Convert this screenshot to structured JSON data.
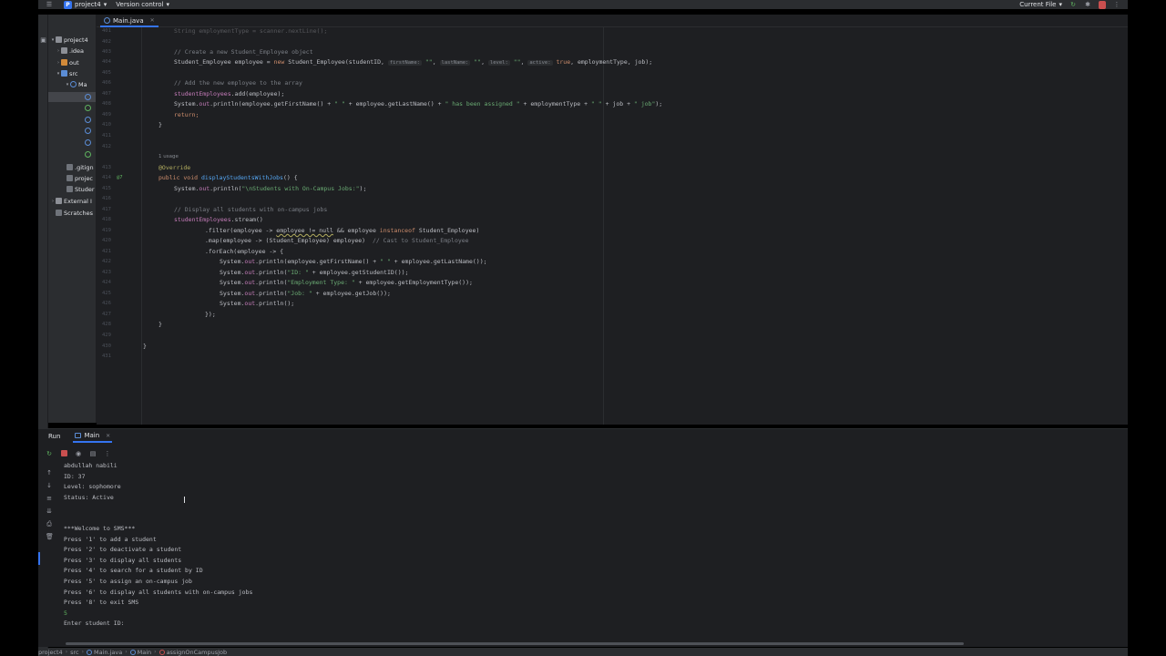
{
  "titlebar": {
    "project_badge": "P",
    "project_name": "project4",
    "vcs_label": "Version control",
    "run_config": "Current File"
  },
  "project_tree": [
    {
      "label": "project4",
      "icon": "folder-icon",
      "arrow": "▾"
    },
    {
      "label": ".idea",
      "icon": "folder-icon",
      "arrow": "›"
    },
    {
      "label": "out",
      "icon": "folder-orange-icon",
      "arrow": "›"
    },
    {
      "label": "src",
      "icon": "folder-blue-icon",
      "arrow": "▾"
    },
    {
      "label": "Ma",
      "icon": "java-class-icon",
      "arrow": "▾"
    },
    {
      "label": "",
      "icon": "java-class-icon",
      "arrow": ""
    },
    {
      "label": "",
      "icon": "interface-icon",
      "arrow": ""
    },
    {
      "label": "",
      "icon": "java-class-icon",
      "arrow": ""
    },
    {
      "label": "",
      "icon": "java-class-icon",
      "arrow": ""
    },
    {
      "label": "",
      "icon": "interface-icon",
      "arrow": ""
    },
    {
      "label": ".gitign",
      "icon": "file-icon",
      "arrow": ""
    },
    {
      "label": "projec",
      "icon": "file-icon",
      "arrow": ""
    },
    {
      "label": "Studer",
      "icon": "file-icon",
      "arrow": ""
    },
    {
      "label": "External I",
      "icon": "library-icon",
      "arrow": "›"
    },
    {
      "label": "Scratches",
      "icon": "scratch-icon",
      "arrow": ""
    }
  ],
  "editor": {
    "tab_label": "Main.java",
    "usage_hint": "1 usage",
    "line_numbers": [
      "401",
      "402",
      "403",
      "404",
      "405",
      "406",
      "407",
      "408",
      "409",
      "410",
      "411",
      "412",
      "413",
      "414",
      "415",
      "416",
      "417",
      "418",
      "419",
      "420",
      "421",
      "422",
      "423",
      "424",
      "425",
      "426",
      "427",
      "428",
      "429",
      "430",
      "431"
    ],
    "override_count": "@7",
    "code": {
      "l0": "String employmentType = scanner.nextLine();",
      "l1": "// Create a new Student_Employee object",
      "l2a": "Student_Employee employee = ",
      "l2b": "new",
      "l2c": " Student_Employee(studentID, ",
      "hint_firstName": "firstName:",
      "hint_lastName": "lastName:",
      "hint_level": "level:",
      "hint_active": "active:",
      "l2d": "\"\"",
      "l2e": ", ",
      "l2f": "true",
      "l2g": ", employmentType, job);",
      "l3": "// Add the new employee to the array",
      "l4a": "studentEmployees",
      "l4b": ".add(employee);",
      "l5a": "System.",
      "l5b": "out",
      "l5c": ".println(employee.getFirstName() + ",
      "l5d": "\" \"",
      "l5e": " + employee.getLastName() + ",
      "l5f": "\" has been assigned \"",
      "l5g": " + employmentType + ",
      "l5h": "\" \"",
      "l5i": " + job + ",
      "l5j": "\" job\"",
      "l5k": ");",
      "l6": "return;",
      "l7": "}",
      "l8": "@Override",
      "l9a": "public void",
      "l9b": " displayStudentsWithJobs",
      "l9c": "() {",
      "l10a": "System.",
      "l10b": "out",
      "l10c": ".println(",
      "l10d": "\"\\nStudents with On-Campus Jobs:\"",
      "l10e": ");",
      "l11": "// Display all students with on-campus jobs",
      "l12a": "studentEmployees",
      "l12b": ".stream()",
      "l13a": ".filter(employee -> ",
      "l13b": "employee != null",
      "l13c": " && employee ",
      "l13d": "instanceof",
      "l13e": " Student_Employee)",
      "l14a": ".map(employee -> (Student_Employee) employee)  ",
      "l14b": "// Cast to Student_Employee",
      "l15": ".forEach(employee -> {",
      "l16a": "System.",
      "l16b": "out",
      "l16c": ".println(employee.getFirstName() + ",
      "l16d": "\" \"",
      "l16e": " + employee.getLastName());",
      "l17c": ".println(",
      "l17d": "\"ID: \"",
      "l17e": " + employee.getStudentID());",
      "l18d": "\"Employment Type: \"",
      "l18e": " + employee.getEmploymentType());",
      "l19d": "\"Job: \"",
      "l19e": " + employee.getJob());",
      "l20c": ".println();",
      "l21": "});",
      "l22": "}",
      "l23": "}"
    }
  },
  "run_panel": {
    "title": "Run",
    "tab_label": "Main",
    "console": [
      "abdullah nabili",
      "ID: 37",
      "Level: sophomore",
      "Status: Active",
      "",
      "",
      "***Welcome to SMS***",
      "Press '1' to add a student",
      "Press '2' to deactivate a student",
      "Press '3' to display all students",
      "Press '4' to search for a student by ID",
      "Press '5' to assign an on-campus job",
      "Press '6' to display all students with on-campus jobs",
      "Press '8' to exit SMS",
      "5",
      "Enter student ID:"
    ]
  },
  "statusbar": {
    "items": [
      "project4",
      "src",
      "Main.java",
      "Main",
      "assignOnCampusJob"
    ]
  }
}
